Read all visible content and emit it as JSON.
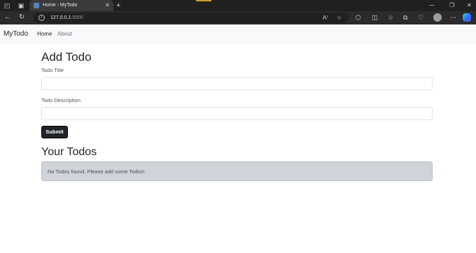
{
  "browser": {
    "tab_title": "Home - MyTodo",
    "tab_close": "✕",
    "new_tab": "+",
    "url_host": "127.0.0.1",
    "url_port": ":5000",
    "window_controls": {
      "minimize": "—",
      "restore": "❐",
      "close": "✕"
    },
    "icons": [
      "workspaces-icon",
      "tab-actions-icon",
      "back-icon",
      "refresh-icon",
      "read-aloud-icon",
      "favorite-icon",
      "extensions-icon",
      "split-screen-icon",
      "favorites-bar-icon",
      "collections-icon",
      "browser-essentials-icon",
      "profile-icon",
      "more-icon",
      "copilot-icon"
    ]
  },
  "navbar": {
    "brand": "MyTodo",
    "links": [
      "Home",
      "About"
    ]
  },
  "form": {
    "heading": "Add Todo",
    "title_label": "Todo Title",
    "title_value": "",
    "desc_label": "Todo Description",
    "desc_value": "",
    "submit_label": "Submit"
  },
  "todos": {
    "heading": "Your Todos",
    "empty_message": "No Todos found. Please add some Todos!"
  },
  "colors": {
    "browser_dark": "#202020",
    "navbar_bg": "#f8f9fa",
    "button_bg": "#212529",
    "alert_bg": "#cfd4da"
  }
}
